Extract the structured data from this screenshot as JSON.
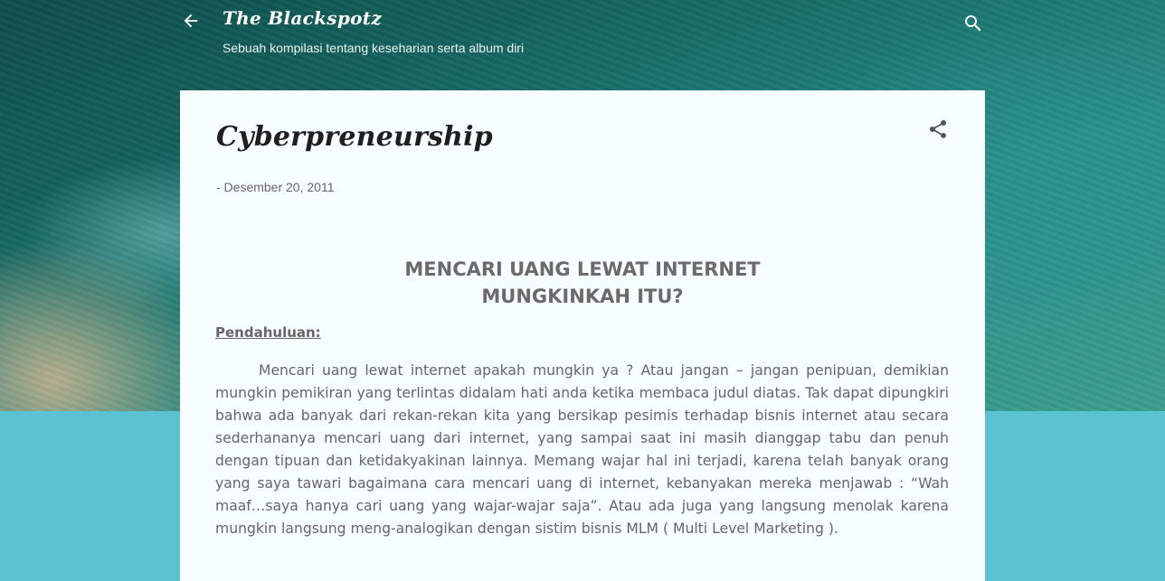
{
  "header": {
    "blog_title": "The Blackspotz",
    "blog_description": "Sebuah kompilasi tentang keseharian serta album diri",
    "back_icon": "arrow-left-icon",
    "search_icon": "search-icon"
  },
  "post": {
    "title": "Cyberpreneurship",
    "date": "- Desember 20, 2011",
    "share_icon": "share-icon",
    "headline_line1": "MENCARI UANG LEWAT INTERNET",
    "headline_line2": "MUNGKINKAH ITU?",
    "section_heading": "Pendahuluan:",
    "paragraph": "Mencari uang lewat internet apakah mungkin ya ? Atau jangan – jangan penipuan, demikian mungkin pemikiran yang terlintas didalam hati anda ketika membaca judul diatas. Tak dapat dipungkiri bahwa ada banyak dari rekan-rekan kita yang bersikap pesimis terhadap bisnis internet atau secara sederhananya mencari uang dari internet, yang sampai saat ini masih dianggap tabu dan penuh dengan tipuan dan ketidakyakinan lainnya. Memang wajar hal ini terjadi, karena telah banyak orang yang saya tawari bagaimana cara mencari uang di internet, kebanyakan mereka menjawab : “Wah maaf…saya hanya cari uang yang wajar-wajar saja”. Atau ada juga yang langsung menolak karena mungkin langsung meng-analogikan dengan sistim bisnis MLM ( Multi Level Marketing )."
  },
  "colors": {
    "page_bg": "#5bc2d2",
    "card_bg": "#f6fefe",
    "text": "#666666",
    "header_text": "#ffffff"
  }
}
